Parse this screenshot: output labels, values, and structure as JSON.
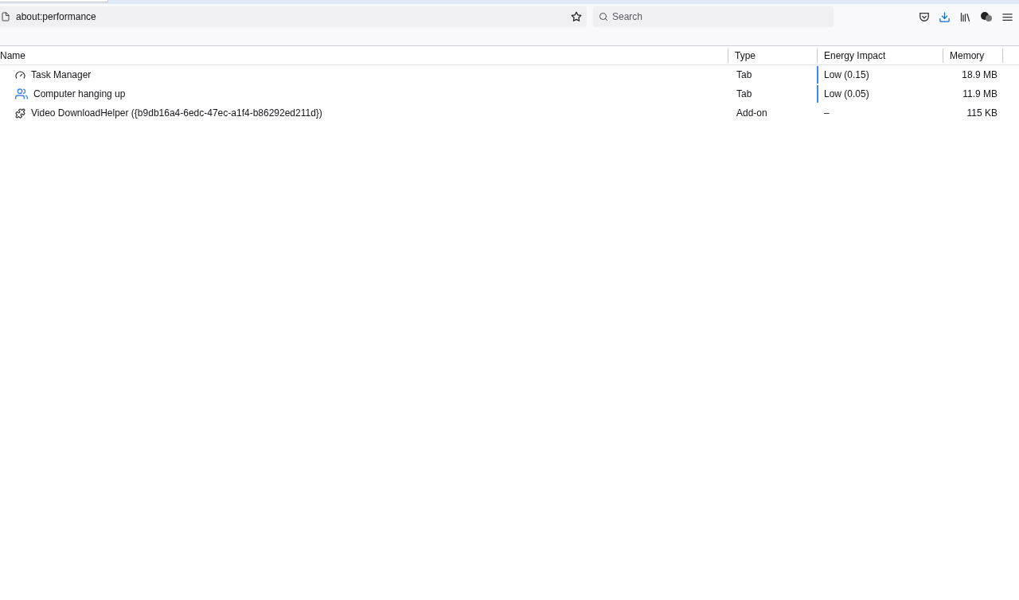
{
  "address_bar": {
    "url": "about:performance"
  },
  "search": {
    "placeholder": "Search"
  },
  "table": {
    "columns": [
      "Name",
      "Type",
      "Energy Impact",
      "Memory"
    ],
    "rows": [
      {
        "kind": "tab",
        "name": "Task Manager",
        "type": "Tab",
        "energy": "Low (0.15)",
        "memory": "18.9 MB"
      },
      {
        "kind": "tab",
        "name": "Computer hanging up",
        "type": "Tab",
        "energy": "Low (0.05)",
        "memory": "11.9 MB"
      },
      {
        "kind": "addon",
        "name": "Video DownloadHelper ({b9db16a4-6edc-47ec-a1f4-b86292ed211d})",
        "type": "Add-on",
        "energy": "–",
        "memory": "115 KB"
      }
    ]
  }
}
